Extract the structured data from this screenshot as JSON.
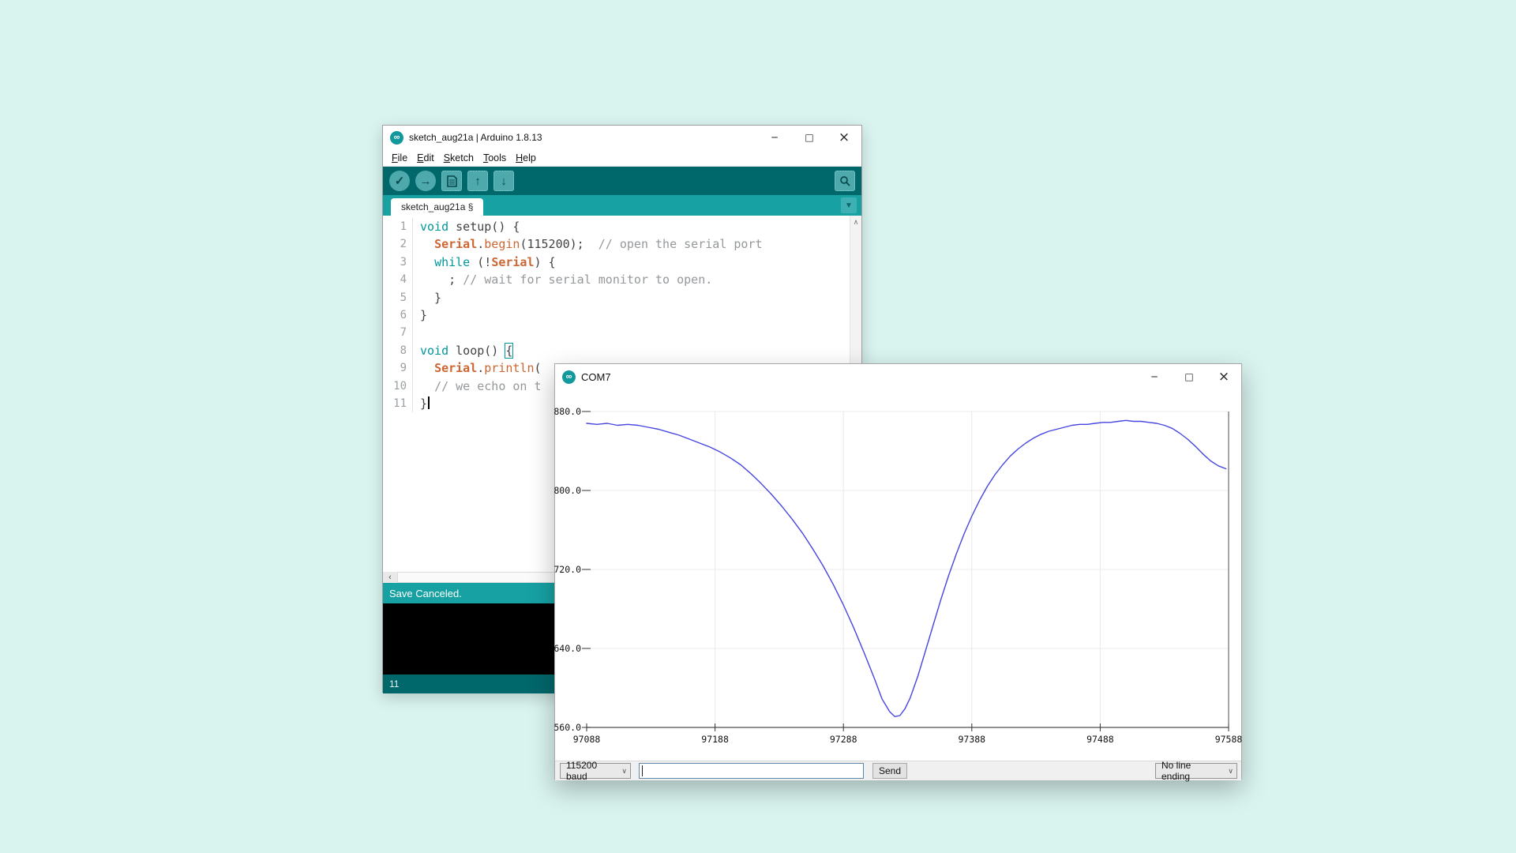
{
  "page": {
    "background": "#d9f3ef"
  },
  "icons": {
    "infinity": "∞",
    "minimize": "─",
    "maximize": "□",
    "close": "×",
    "verify_check": "✓",
    "upload_arrow": "→",
    "open_up": "↑",
    "save_down": "↓",
    "dropdown": "▼",
    "scroll_up": "∧",
    "scroll_left": "‹",
    "chevron_down": "∨"
  },
  "arduino_window": {
    "title": "sketch_aug21a | Arduino 1.8.13",
    "menu_items": [
      "File",
      "Edit",
      "Sketch",
      "Tools",
      "Help"
    ],
    "toolbar_icons": [
      "verify-check",
      "upload-arrow",
      "new-document",
      "open-up-arrow",
      "save-down-arrow"
    ],
    "toolbar_right_icon": "serial-monitor-magnifier",
    "tab_label": "sketch_aug21a §",
    "status_text": "Save Canceled.",
    "bottom_left_text": "11",
    "code_lines": [
      {
        "n": "1",
        "tokens": [
          {
            "c": "kw",
            "t": "void"
          },
          {
            "c": "pln",
            "t": " setup() {"
          }
        ]
      },
      {
        "n": "2",
        "tokens": [
          {
            "c": "pln",
            "t": "  "
          },
          {
            "c": "obj",
            "t": "Serial"
          },
          {
            "c": "pln",
            "t": "."
          },
          {
            "c": "fn",
            "t": "begin"
          },
          {
            "c": "pln",
            "t": "(115200);  "
          },
          {
            "c": "com",
            "t": "// open the serial port"
          }
        ]
      },
      {
        "n": "3",
        "tokens": [
          {
            "c": "pln",
            "t": "  "
          },
          {
            "c": "kw",
            "t": "while"
          },
          {
            "c": "pln",
            "t": " (!"
          },
          {
            "c": "obj",
            "t": "Serial"
          },
          {
            "c": "pln",
            "t": ") {"
          }
        ]
      },
      {
        "n": "4",
        "tokens": [
          {
            "c": "pln",
            "t": "    ; "
          },
          {
            "c": "com",
            "t": "// wait for serial monitor to open."
          }
        ]
      },
      {
        "n": "5",
        "tokens": [
          {
            "c": "pln",
            "t": "  }"
          }
        ]
      },
      {
        "n": "6",
        "tokens": [
          {
            "c": "pln",
            "t": "}"
          }
        ]
      },
      {
        "n": "7",
        "tokens": []
      },
      {
        "n": "8",
        "tokens": [
          {
            "c": "kw",
            "t": "void"
          },
          {
            "c": "pln",
            "t": " loop() "
          },
          {
            "c": "brace",
            "t": "{"
          }
        ]
      },
      {
        "n": "9",
        "tokens": [
          {
            "c": "pln",
            "t": "  "
          },
          {
            "c": "obj",
            "t": "Serial"
          },
          {
            "c": "pln",
            "t": "."
          },
          {
            "c": "fn",
            "t": "println"
          },
          {
            "c": "pln",
            "t": "("
          }
        ]
      },
      {
        "n": "10",
        "tokens": [
          {
            "c": "pln",
            "t": "  "
          },
          {
            "c": "com",
            "t": "// we echo on t"
          }
        ]
      },
      {
        "n": "11",
        "tokens": [
          {
            "c": "pln",
            "t": "}"
          },
          {
            "c": "caret",
            "t": ""
          }
        ]
      }
    ],
    "colors": {
      "toolbar_bg": "#00676b",
      "strip_bg": "#17a1a3",
      "status_bg": "#17a1a3",
      "keyword": "#00979c",
      "object": "#cc6633",
      "comment": "#95989b"
    }
  },
  "plotter_window": {
    "title": "COM7",
    "controls": {
      "baud_selected": "115200 baud",
      "input_value": "",
      "send_label": "Send",
      "line_ending_selected": "No line ending"
    }
  },
  "chart_data": {
    "type": "line",
    "title": "",
    "xlabel": "",
    "ylabel": "",
    "xlim": [
      97088,
      97588
    ],
    "ylim": [
      560,
      880
    ],
    "x_ticks": [
      97088,
      97188,
      97288,
      97388,
      97488,
      97588
    ],
    "x_tick_labels": [
      "97088",
      "97188",
      "97288",
      "97388",
      "97488",
      "97588"
    ],
    "y_ticks": [
      880,
      800,
      720,
      640,
      560
    ],
    "y_tick_labels": [
      "880.0",
      "800.0",
      "720.0",
      "640.0",
      "560.0"
    ],
    "grid": true,
    "legend": false,
    "line_color": "#4646e0",
    "series": [
      {
        "name": "serial-value",
        "points": [
          [
            97088,
            868
          ],
          [
            97096,
            867
          ],
          [
            97104,
            868
          ],
          [
            97112,
            866
          ],
          [
            97120,
            867
          ],
          [
            97128,
            866
          ],
          [
            97136,
            864
          ],
          [
            97144,
            862
          ],
          [
            97152,
            859
          ],
          [
            97160,
            856
          ],
          [
            97168,
            852
          ],
          [
            97176,
            848
          ],
          [
            97184,
            844
          ],
          [
            97192,
            839
          ],
          [
            97200,
            833
          ],
          [
            97208,
            826
          ],
          [
            97216,
            817
          ],
          [
            97224,
            807
          ],
          [
            97232,
            796
          ],
          [
            97240,
            784
          ],
          [
            97248,
            771
          ],
          [
            97256,
            757
          ],
          [
            97264,
            741
          ],
          [
            97272,
            724
          ],
          [
            97280,
            705
          ],
          [
            97288,
            684
          ],
          [
            97296,
            661
          ],
          [
            97304,
            636
          ],
          [
            97312,
            610
          ],
          [
            97318,
            589
          ],
          [
            97324,
            576
          ],
          [
            97328,
            571
          ],
          [
            97332,
            572
          ],
          [
            97336,
            579
          ],
          [
            97340,
            590
          ],
          [
            97346,
            612
          ],
          [
            97352,
            638
          ],
          [
            97358,
            664
          ],
          [
            97364,
            690
          ],
          [
            97370,
            714
          ],
          [
            97376,
            736
          ],
          [
            97382,
            756
          ],
          [
            97388,
            774
          ],
          [
            97394,
            790
          ],
          [
            97400,
            804
          ],
          [
            97406,
            816
          ],
          [
            97412,
            826
          ],
          [
            97418,
            835
          ],
          [
            97424,
            842
          ],
          [
            97430,
            848
          ],
          [
            97436,
            853
          ],
          [
            97442,
            857
          ],
          [
            97448,
            860
          ],
          [
            97454,
            862
          ],
          [
            97460,
            864
          ],
          [
            97466,
            866
          ],
          [
            97472,
            867
          ],
          [
            97478,
            867
          ],
          [
            97484,
            868
          ],
          [
            97490,
            869
          ],
          [
            97496,
            869
          ],
          [
            97502,
            870
          ],
          [
            97508,
            871
          ],
          [
            97514,
            870
          ],
          [
            97520,
            870
          ],
          [
            97526,
            869
          ],
          [
            97532,
            868
          ],
          [
            97538,
            866
          ],
          [
            97544,
            863
          ],
          [
            97550,
            858
          ],
          [
            97556,
            852
          ],
          [
            97562,
            845
          ],
          [
            97568,
            837
          ],
          [
            97574,
            830
          ],
          [
            97580,
            825
          ],
          [
            97586,
            822
          ]
        ]
      }
    ]
  }
}
